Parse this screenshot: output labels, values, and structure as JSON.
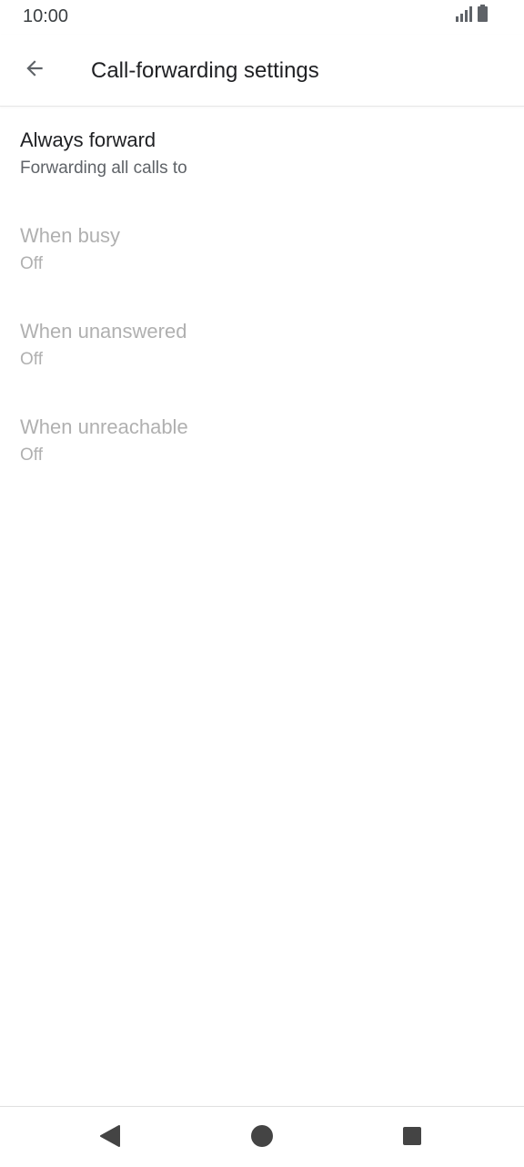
{
  "status_bar": {
    "time": "10:00",
    "icons": [
      "signal-icon",
      "battery-icon"
    ]
  },
  "app_bar": {
    "back_icon": "arrow-back-icon",
    "title": "Call-forwarding settings"
  },
  "list": {
    "items": [
      {
        "title": "Always forward",
        "summary": "Forwarding all calls to",
        "enabled": true
      },
      {
        "title": "When busy",
        "summary": "Off",
        "enabled": false
      },
      {
        "title": "When unanswered",
        "summary": "Off",
        "enabled": false
      },
      {
        "title": "When unreachable",
        "summary": "Off",
        "enabled": false
      }
    ]
  },
  "nav_bar": {
    "icons": [
      "nav-back-icon",
      "nav-home-icon",
      "nav-recents-icon"
    ]
  },
  "colors": {
    "primary_text": "#202124",
    "secondary_text": "#5f6368",
    "disabled_text": "#b0b0b0",
    "icon": "#5f6368",
    "nav_icon": "#444444"
  }
}
